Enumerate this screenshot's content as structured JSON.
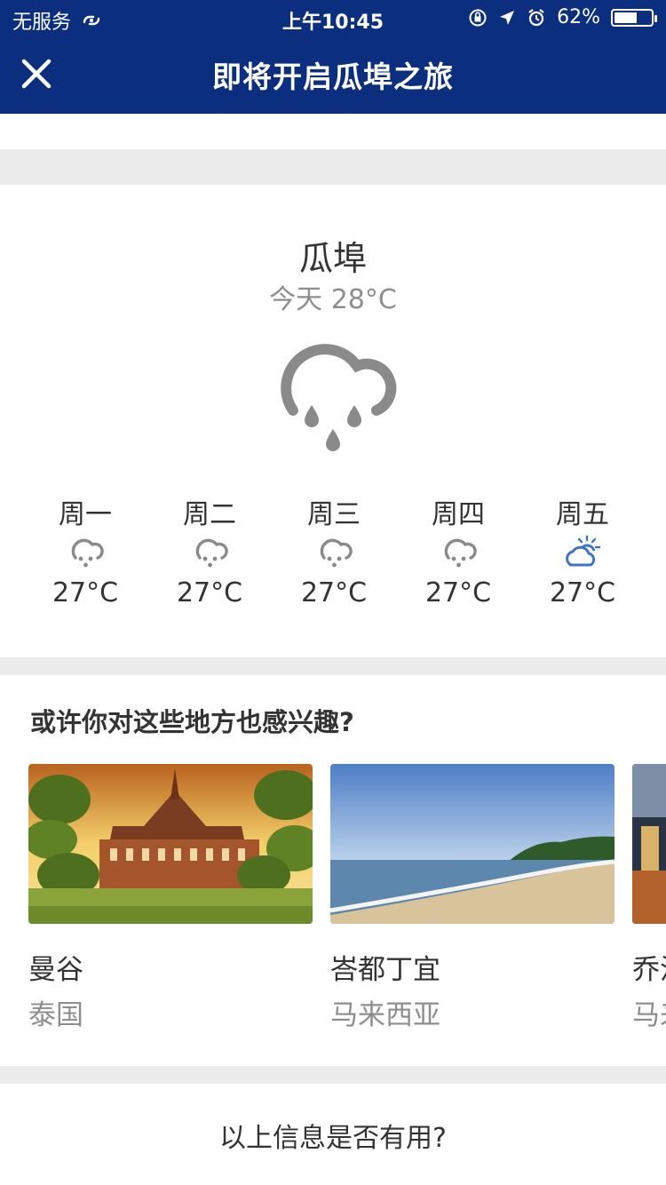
{
  "status_bar": {
    "carrier": "无服务",
    "time": "上午10:45",
    "battery_percent": "62%",
    "battery_level": 0.62
  },
  "nav": {
    "title": "即将开启瓜埠之旅"
  },
  "weather": {
    "city": "瓜埠",
    "today": "今天 28°C",
    "today_icon": "rain-cloud-icon",
    "forecast": [
      {
        "day": "周一",
        "temp": "27°C",
        "icon": "rain-icon"
      },
      {
        "day": "周二",
        "temp": "27°C",
        "icon": "rain-icon"
      },
      {
        "day": "周三",
        "temp": "27°C",
        "icon": "rain-icon"
      },
      {
        "day": "周四",
        "temp": "27°C",
        "icon": "rain-icon"
      },
      {
        "day": "周五",
        "temp": "27°C",
        "icon": "partly-cloudy-icon"
      }
    ]
  },
  "suggestions": {
    "heading": "或许你对这些地方也感兴趣?",
    "items": [
      {
        "name": "曼谷",
        "country": "泰国"
      },
      {
        "name": "峇都丁宜",
        "country": "马来西亚"
      },
      {
        "name": "乔治",
        "country": "马来西亚"
      }
    ]
  },
  "feedback": {
    "question": "以上信息是否有用?"
  },
  "colors": {
    "brand": "#0b2f7e",
    "accent_icon": "#3f74c4",
    "icon_gray": "#8a8a8a",
    "divider": "#ececec"
  }
}
